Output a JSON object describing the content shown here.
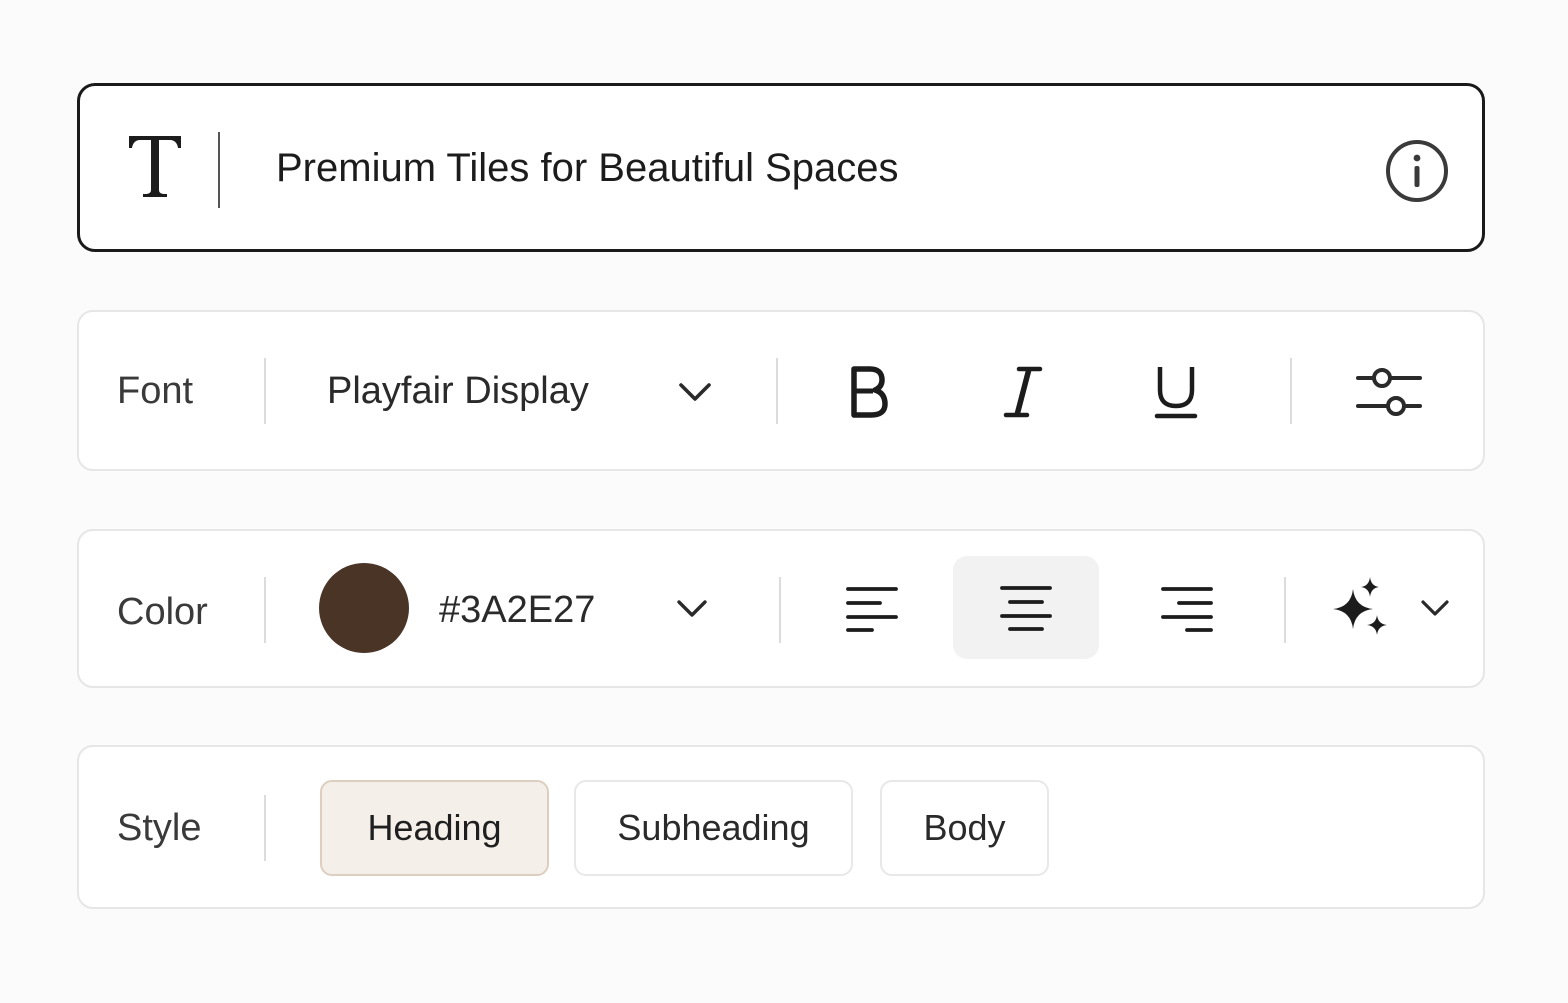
{
  "text_field": {
    "type_icon": "text-type-icon",
    "value": "Premium Tiles for Beautiful Spaces",
    "info_icon": "info-icon"
  },
  "font_row": {
    "label": "Font",
    "font_name": "Playfair Display",
    "dropdown_icon": "chevron-down-icon",
    "bold_icon": "bold-icon",
    "italic_icon": "italic-icon",
    "underline_icon": "underline-icon",
    "settings_icon": "sliders-icon"
  },
  "color_row": {
    "label": "Color",
    "hex": "#3A2E27",
    "swatch_color": "#4a3426",
    "dropdown_icon": "chevron-down-icon",
    "align_options": [
      "align-left",
      "align-center",
      "align-right"
    ],
    "align_selected": "align-center",
    "effects_icon": "sparkles-icon"
  },
  "style_row": {
    "label": "Style",
    "chips": [
      {
        "label": "Heading",
        "selected": true
      },
      {
        "label": "Subheading",
        "selected": false
      },
      {
        "label": "Body",
        "selected": false
      }
    ]
  }
}
